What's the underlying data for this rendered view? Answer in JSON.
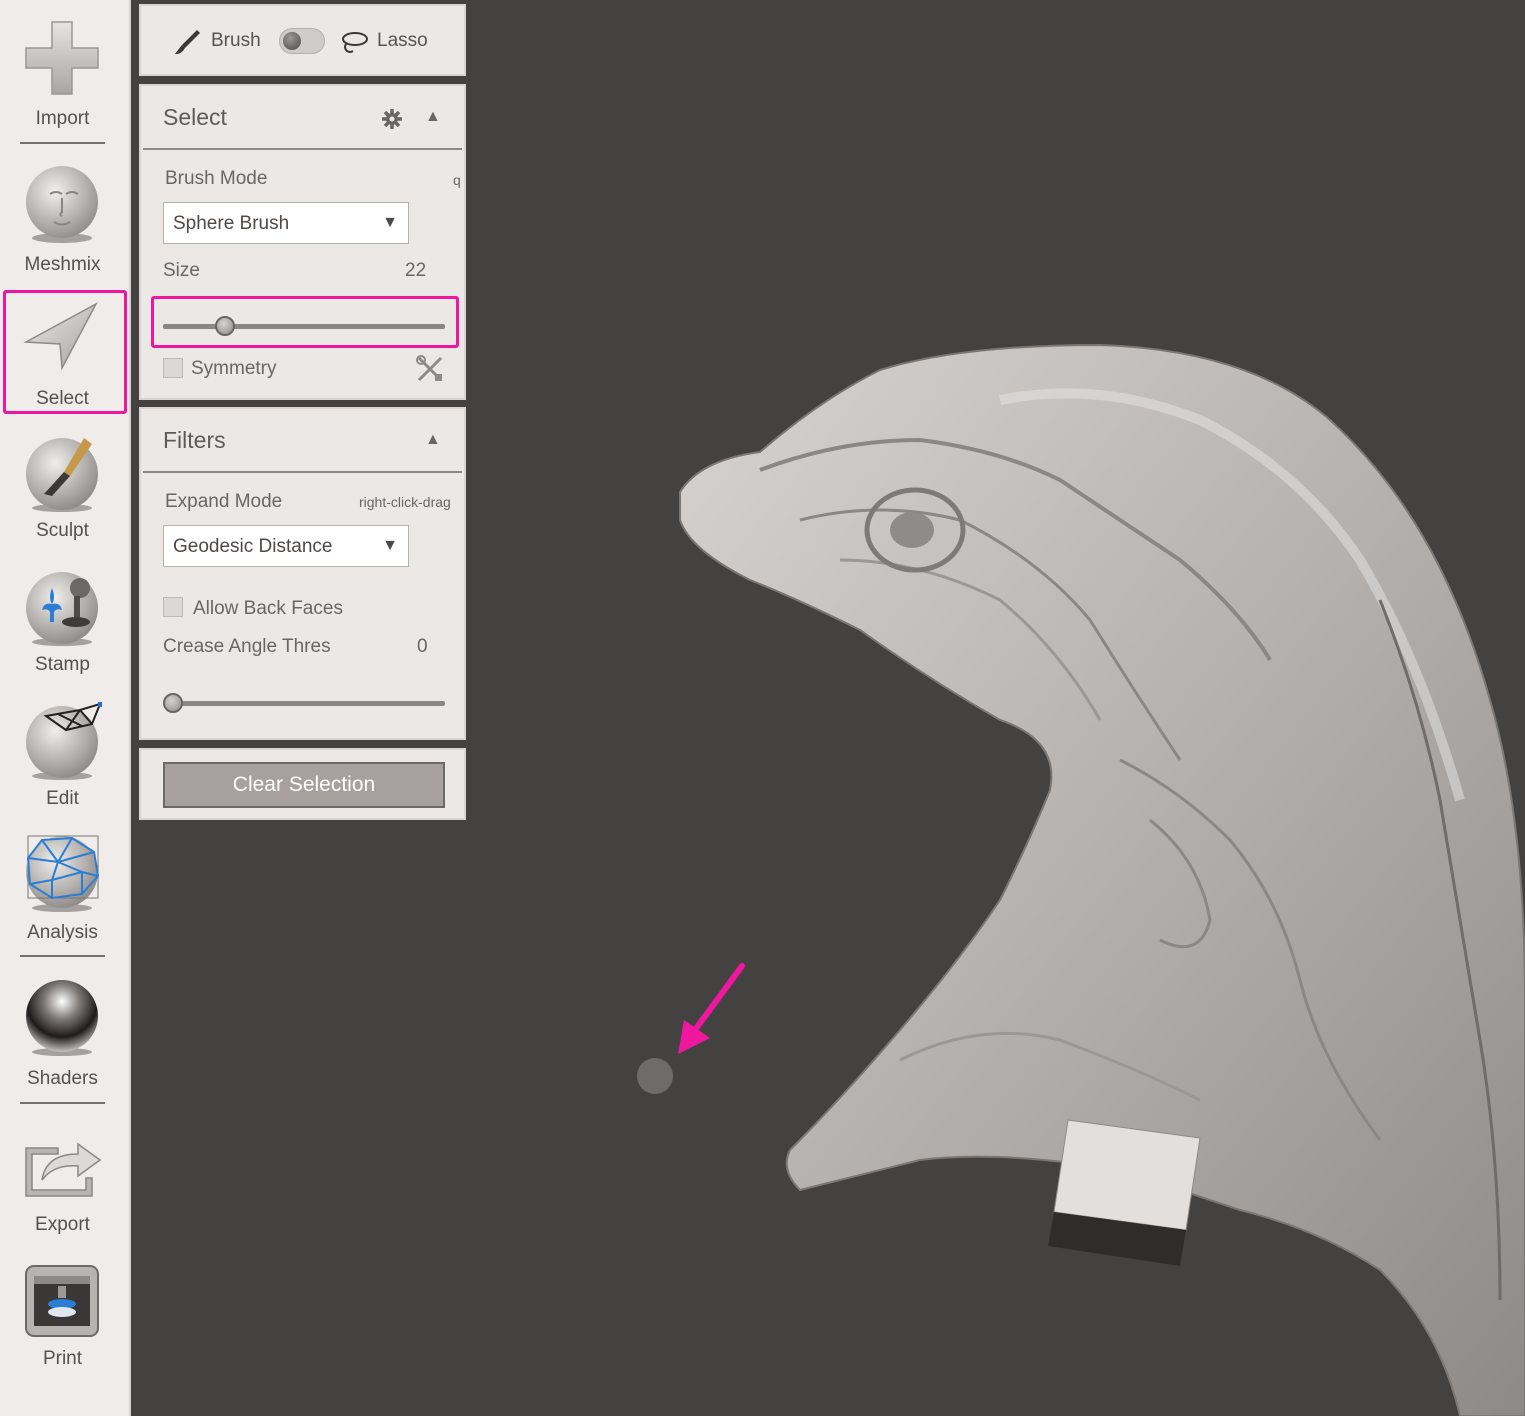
{
  "toolbar": {
    "items": [
      {
        "label": "Import",
        "icon": "import-plus-icon"
      },
      {
        "label": "Meshmix",
        "icon": "meshmix-head-icon"
      },
      {
        "label": "Select",
        "icon": "select-arrow-icon"
      },
      {
        "label": "Sculpt",
        "icon": "sculpt-brush-icon"
      },
      {
        "label": "Stamp",
        "icon": "stamp-icon"
      },
      {
        "label": "Edit",
        "icon": "edit-mesh-icon"
      },
      {
        "label": "Analysis",
        "icon": "analysis-mesh-icon"
      },
      {
        "label": "Shaders",
        "icon": "shaders-sphere-icon"
      },
      {
        "label": "Export",
        "icon": "export-icon"
      },
      {
        "label": "Print",
        "icon": "print-icon"
      }
    ],
    "active": "Select"
  },
  "mode_bar": {
    "brush_label": "Brush",
    "lasso_label": "Lasso",
    "toggle_on": false
  },
  "select_panel": {
    "title": "Select",
    "brush_mode_label": "Brush Mode",
    "brush_mode_hotkey": "q",
    "brush_mode_value": "Sphere Brush",
    "size_label": "Size",
    "size_value": "22",
    "size_fraction": 0.2,
    "symmetry_label": "Symmetry",
    "symmetry_checked": false
  },
  "filters_panel": {
    "title": "Filters",
    "expand_mode_label": "Expand Mode",
    "expand_mode_hint": "right-click-drag",
    "expand_mode_value": "Geodesic Distance",
    "allow_back_faces_label": "Allow Back Faces",
    "allow_back_faces_checked": false,
    "crease_angle_label": "Crease Angle Thres",
    "crease_angle_value": "0",
    "crease_fraction": 0.0
  },
  "actions": {
    "clear_selection_label": "Clear Selection"
  },
  "colors": {
    "highlight": "#f0179f",
    "viewport_bg": "#434241",
    "panel_bg": "#ece8e5"
  }
}
